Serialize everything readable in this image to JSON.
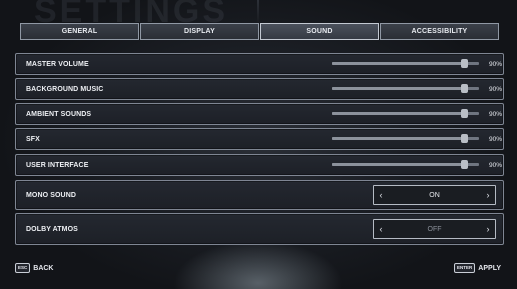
{
  "page": {
    "title": "SETTINGS"
  },
  "tabs": [
    {
      "label": "GENERAL",
      "active": false
    },
    {
      "label": "DISPLAY",
      "active": false
    },
    {
      "label": "SOUND",
      "active": true
    },
    {
      "label": "ACCESSIBILITY",
      "active": false
    }
  ],
  "sound": {
    "sliders": [
      {
        "label": "MASTER VOLUME",
        "value": 90,
        "value_text": "90%"
      },
      {
        "label": "BACKGROUND MUSIC",
        "value": 90,
        "value_text": "90%"
      },
      {
        "label": "AMBIENT SOUNDS",
        "value": 90,
        "value_text": "90%"
      },
      {
        "label": "SFX",
        "value": 90,
        "value_text": "90%"
      },
      {
        "label": "USER INTERFACE",
        "value": 90,
        "value_text": "90%"
      }
    ],
    "mono_sound": {
      "label": "MONO SOUND",
      "value": "ON"
    },
    "dolby_atmos": {
      "label": "DOLBY ATMOS",
      "value": "OFF"
    }
  },
  "footer": {
    "back": {
      "key": "ESC",
      "label": "BACK"
    },
    "apply": {
      "key": "ENTER",
      "label": "APPLY"
    }
  }
}
